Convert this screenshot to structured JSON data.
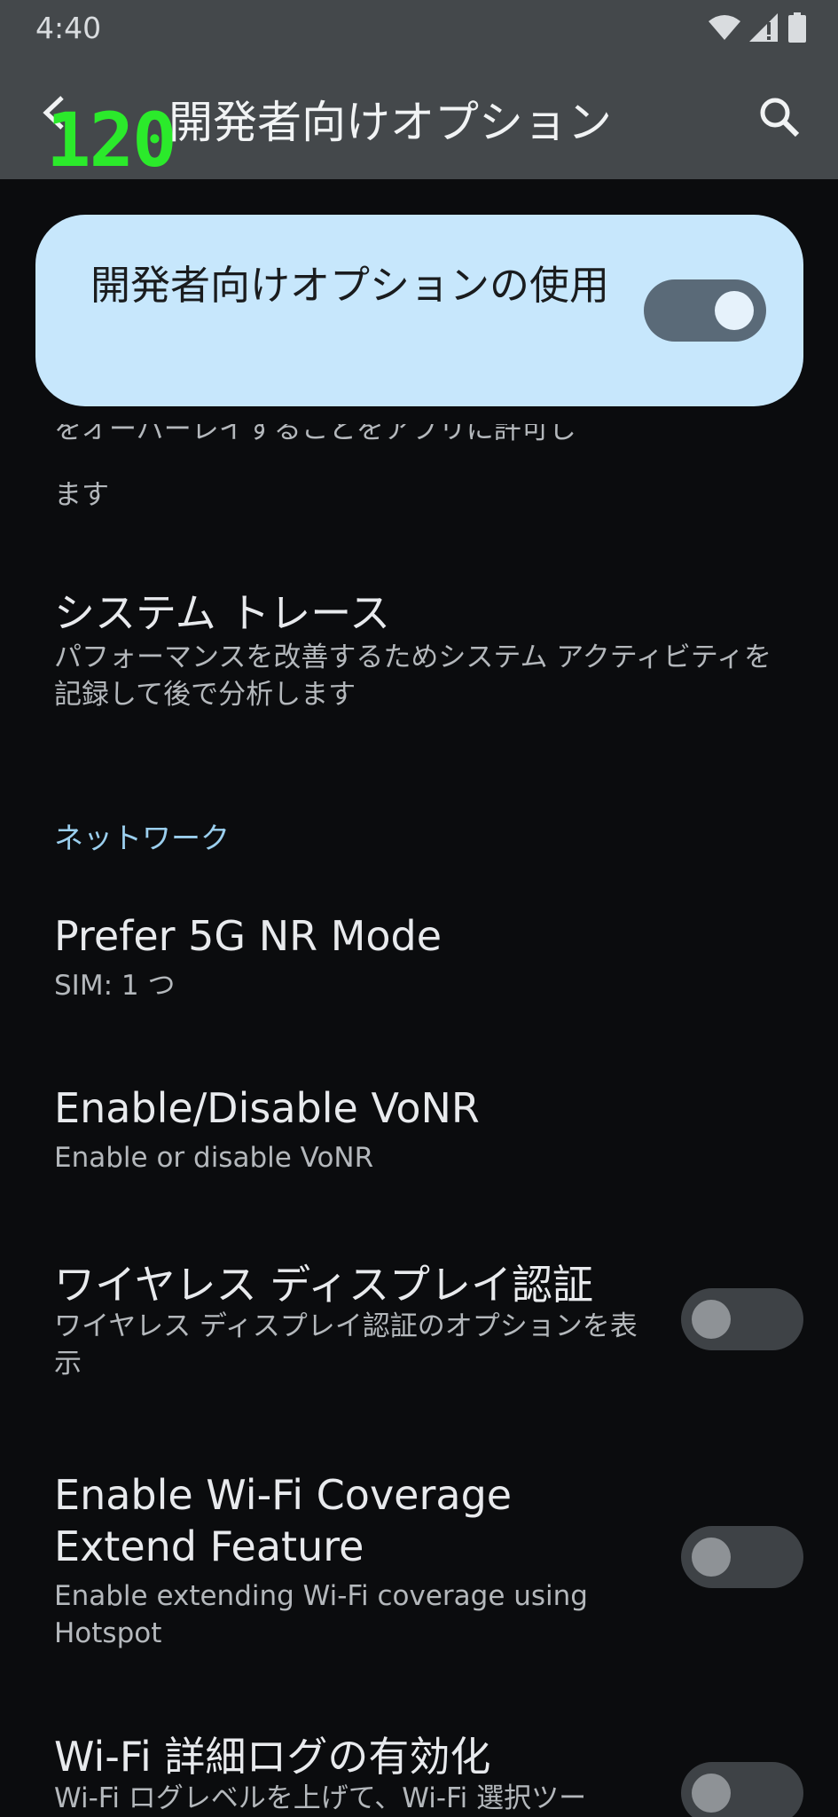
{
  "status_bar": {
    "time": "4:40"
  },
  "app_bar": {
    "title": "開発者向けオプション",
    "fps_counter": "120"
  },
  "master_toggle": {
    "label": "開発者向けオプションの使用",
    "state": "on"
  },
  "partial_item": {
    "sub_line1": "をオーバーレイすることをアプリに許可し",
    "sub_line2": "ます"
  },
  "items": [
    {
      "title": "システム トレース",
      "subtitle": "パフォーマンスを改善するためシステム アクティビティを記録して後で分析します"
    },
    {
      "title": "Prefer 5G NR Mode",
      "subtitle": "SIM: 1 つ"
    },
    {
      "title": "Enable/Disable VoNR",
      "subtitle": "Enable or disable VoNR"
    },
    {
      "title": "ワイヤレス ディスプレイ認証",
      "subtitle": "ワイヤレス ディスプレイ認証のオプションを表示",
      "toggle": "off"
    },
    {
      "title": "Enable Wi-Fi Coverage Extend Feature",
      "subtitle": "Enable extending Wi-Fi coverage using Hotspot",
      "toggle": "off"
    },
    {
      "title": "Wi-Fi 詳細ログの有効化",
      "subtitle": "Wi-Fi ログレベルを上げて、Wi-Fi 選択ツー",
      "toggle": "off"
    }
  ],
  "section_header": "ネットワーク",
  "colors": {
    "app_bar": "#44484b",
    "background": "#0b0c0e",
    "card": "#c7e7fc",
    "accent": "#9bcfee",
    "fps": "#2bea2b"
  },
  "icons": [
    "wifi-icon",
    "signal-icon",
    "battery-icon",
    "back-arrow-icon",
    "search-icon"
  ]
}
